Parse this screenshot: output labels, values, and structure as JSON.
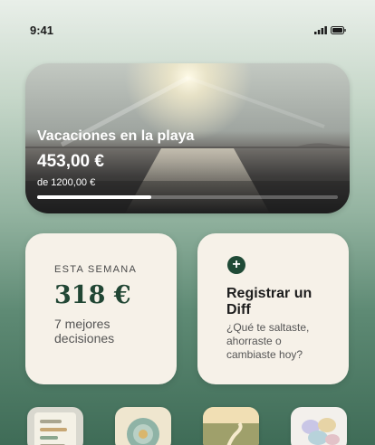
{
  "status": {
    "time": "9:41"
  },
  "goal": {
    "title": "Vacaciones en la playa",
    "amount": "453,00 €",
    "target": "de 1200,00 €",
    "progress": 0.38
  },
  "week": {
    "label": "ESTA SEMANA",
    "amount": "318 €",
    "subtitle": "7 mejores decisiones"
  },
  "diff": {
    "title": "Registrar un Diff",
    "subtitle": "¿Qué te saltaste, ahorraste o cambiaste hoy?"
  },
  "colors": {
    "accent": "#1f4a36",
    "card": "#f6f1e8"
  },
  "shortcuts": [
    {
      "icon": "notes-icon"
    },
    {
      "icon": "flower-icon"
    },
    {
      "icon": "path-icon"
    },
    {
      "icon": "petals-icon"
    }
  ]
}
